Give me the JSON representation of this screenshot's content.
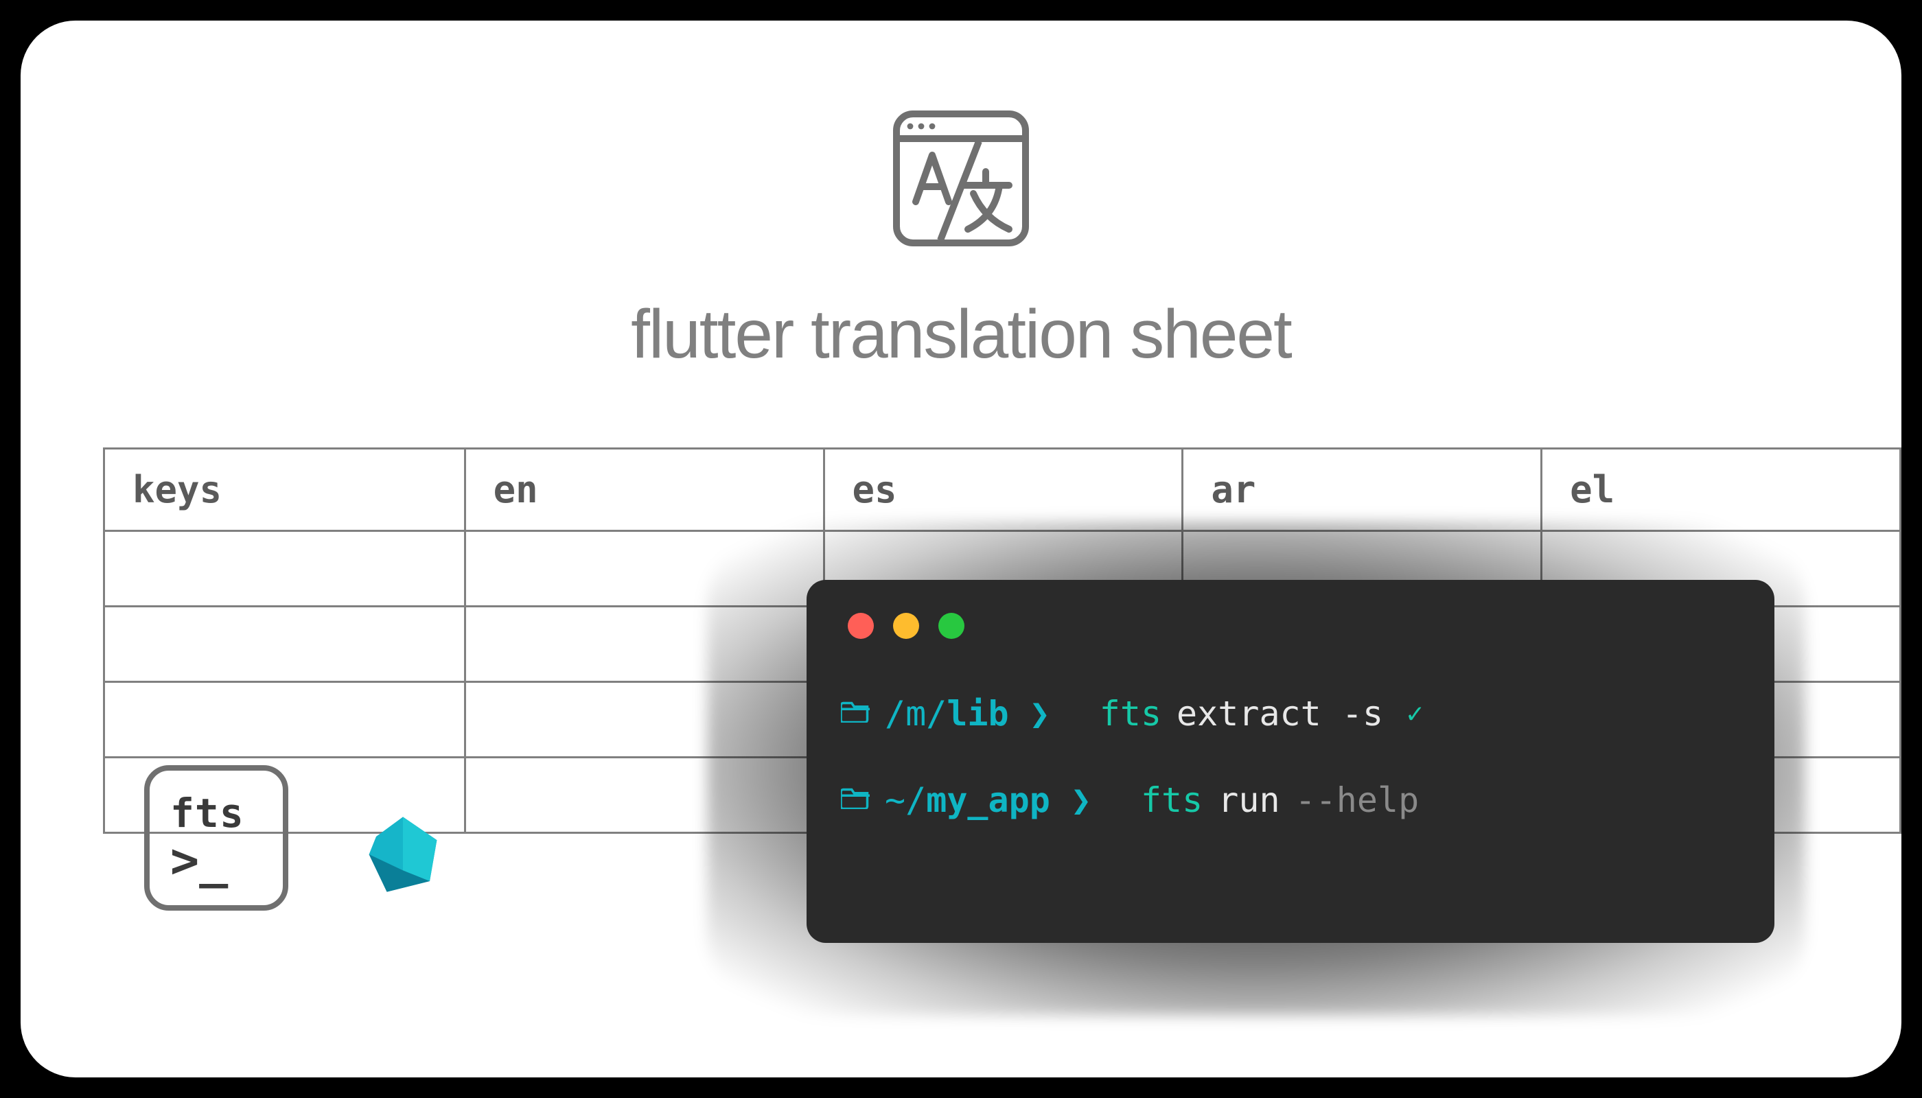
{
  "title": "flutter translation sheet",
  "sheet": {
    "headers": [
      "keys",
      "en",
      "es",
      "ar",
      "el"
    ]
  },
  "fts_badge": {
    "label": "fts",
    "prompt": ">_"
  },
  "terminal": {
    "lines": [
      {
        "path_prefix": "/m/",
        "path_bold": "lib",
        "cmd": "fts",
        "args": "extract -s",
        "flag": "",
        "success": true
      },
      {
        "path_prefix": "~/",
        "path_bold": "my_app",
        "cmd": "fts",
        "args": "run",
        "flag": "--help",
        "success": false
      }
    ]
  }
}
